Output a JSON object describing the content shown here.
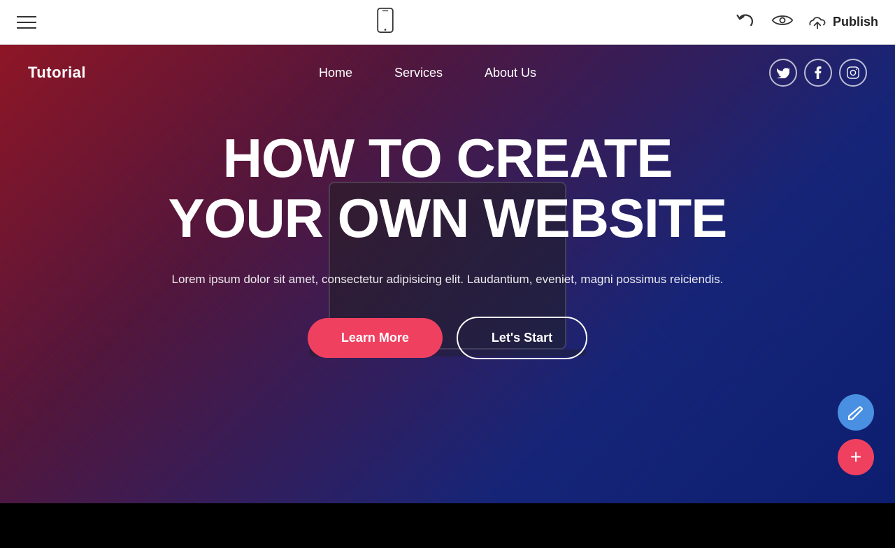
{
  "toolbar": {
    "hamburger_label": "Menu",
    "publish_label": "Publish",
    "undo_label": "Undo",
    "preview_label": "Preview"
  },
  "site": {
    "logo": "Tutorial",
    "nav": {
      "links": [
        {
          "label": "Home"
        },
        {
          "label": "Services"
        },
        {
          "label": "About Us"
        }
      ]
    },
    "social": {
      "twitter_label": "T",
      "facebook_label": "f",
      "instagram_label": "in"
    },
    "hero": {
      "title_line1": "HOW TO CREATE",
      "title_line2": "YOUR OWN WEBSITE",
      "subtitle": "Lorem ipsum dolor sit amet, consectetur adipisicing elit. Laudantium, eveniet, magni possimus reiciendis.",
      "btn_learn_more": "Learn More",
      "btn_lets_start": "Let's Start"
    }
  },
  "fab": {
    "edit_icon": "✏",
    "add_icon": "+"
  }
}
